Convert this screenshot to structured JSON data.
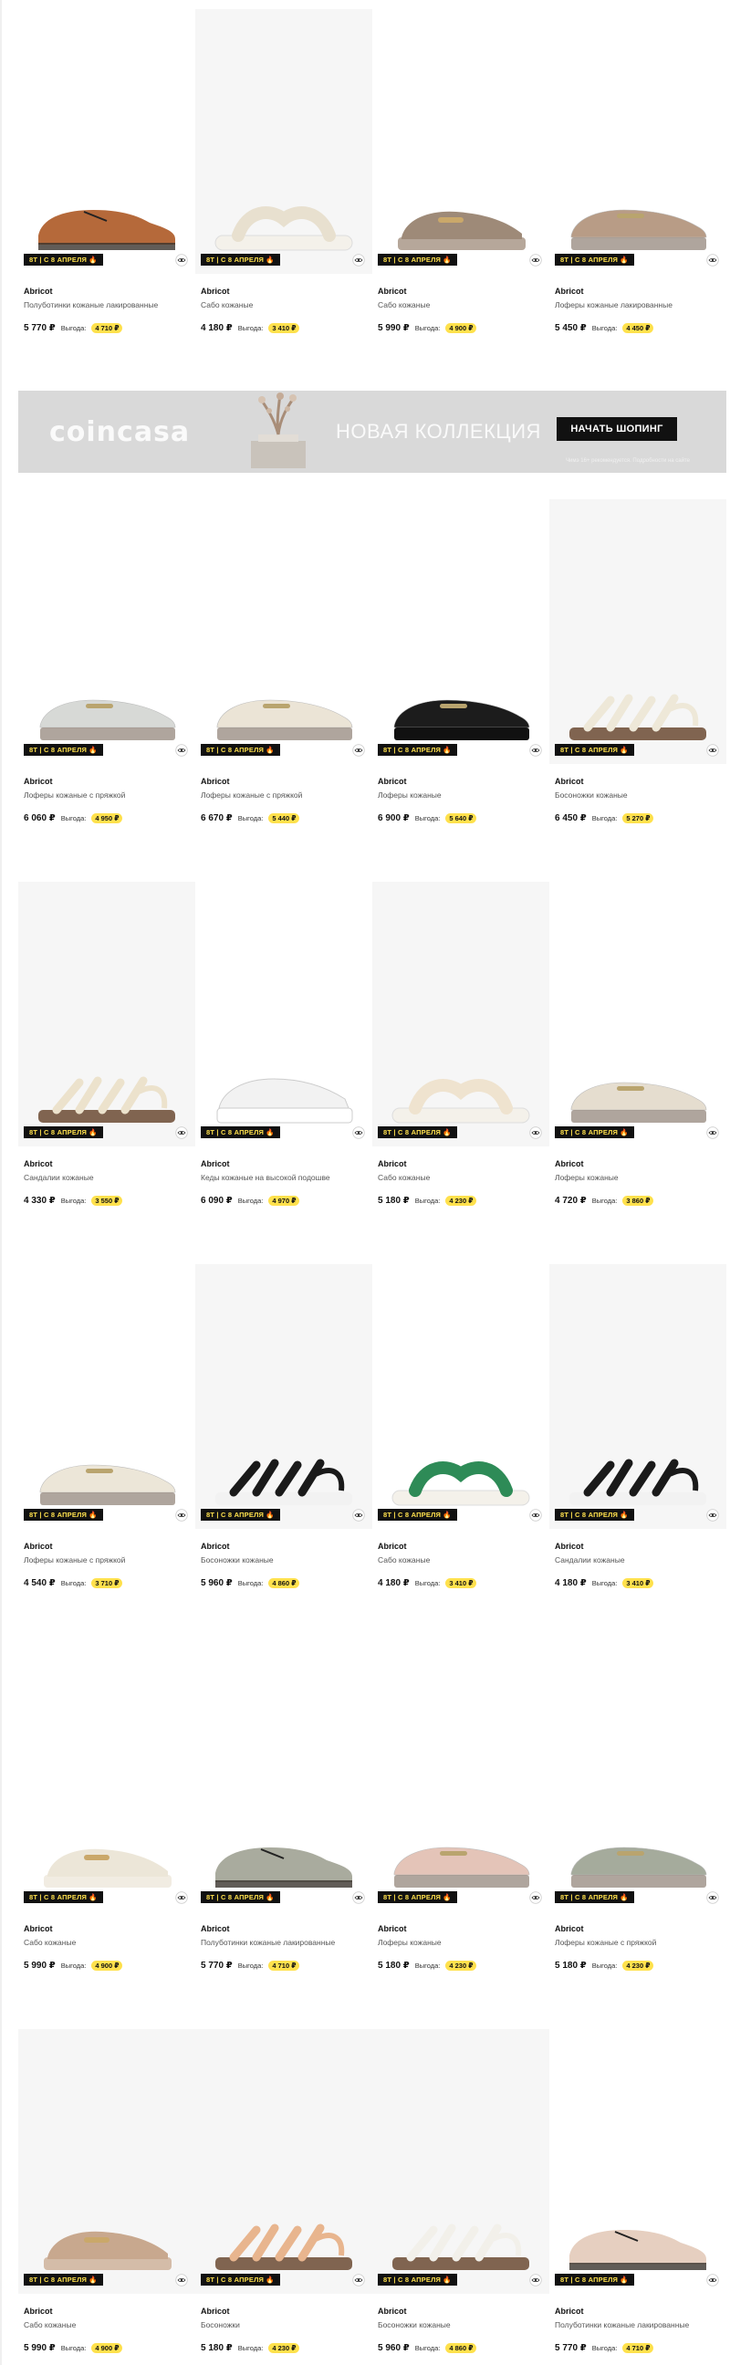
{
  "badge_text": "8Т | С 8 АПРЕЛЯ 🔥",
  "gain_label": "Выгода:",
  "banner": {
    "logo": "coincasa",
    "title": "НОВАЯ КОЛЛЕКЦИЯ",
    "cta": "НАЧАТЬ ШОПИНГ",
    "small_text": "Чимэ 16+ рекомендуется. Подробности на сайте"
  },
  "rows": [
    [
      {
        "brand": "Abricot",
        "desc": "Полуботинки кожаные лакированные",
        "price": "5 770 ₽",
        "gain": "4 710 ₽",
        "bg": false,
        "shoe": "oxford",
        "color": "#b5693a"
      },
      {
        "brand": "Abricot",
        "desc": "Сабо кожаные",
        "price": "4 180 ₽",
        "gain": "3 410 ₽",
        "bg": true,
        "shoe": "slide",
        "color": "#e8e0cf"
      },
      {
        "brand": "Abricot",
        "desc": "Сабо кожаные",
        "price": "5 990 ₽",
        "gain": "4 900 ₽",
        "bg": false,
        "shoe": "mule",
        "color": "#9e8a78"
      },
      {
        "brand": "Abricot",
        "desc": "Лоферы кожаные лакированные",
        "price": "5 450 ₽",
        "gain": "4 450 ₽",
        "bg": false,
        "shoe": "loafer",
        "color": "#b89c86"
      }
    ],
    [
      {
        "brand": "Abricot",
        "desc": "Лоферы кожаные с пряжкой",
        "price": "6 060 ₽",
        "gain": "4 950 ₽",
        "bg": false,
        "shoe": "loafer",
        "color": "#d7d9d6"
      },
      {
        "brand": "Abricot",
        "desc": "Лоферы кожаные с пряжкой",
        "price": "6 670 ₽",
        "gain": "5 440 ₽",
        "bg": false,
        "shoe": "loafer",
        "color": "#ebe4d6"
      },
      {
        "brand": "Abricot",
        "desc": "Лоферы кожаные",
        "price": "6 900 ₽",
        "gain": "5 640 ₽",
        "bg": false,
        "shoe": "loafer",
        "color": "#1c1c1c"
      },
      {
        "brand": "Abricot",
        "desc": "Босоножки кожаные",
        "price": "6 450 ₽",
        "gain": "5 270 ₽",
        "bg": true,
        "shoe": "sandal",
        "color": "#eee8d8"
      }
    ],
    [
      {
        "brand": "Abricot",
        "desc": "Сандалии кожаные",
        "price": "4 330 ₽",
        "gain": "3 550 ₽",
        "bg": true,
        "shoe": "sandal",
        "color": "#ece2cc"
      },
      {
        "brand": "Abricot",
        "desc": "Кеды кожаные на высокой подошве",
        "price": "6 090 ₽",
        "gain": "4 970 ₽",
        "bg": false,
        "shoe": "sneaker",
        "color": "#f2f2f2"
      },
      {
        "brand": "Abricot",
        "desc": "Сабо кожаные",
        "price": "5 180 ₽",
        "gain": "4 230 ₽",
        "bg": true,
        "shoe": "slide",
        "color": "#efe3cf"
      },
      {
        "brand": "Abricot",
        "desc": "Лоферы кожаные",
        "price": "4 720 ₽",
        "gain": "3 860 ₽",
        "bg": false,
        "shoe": "loafer",
        "color": "#e5ddcf"
      }
    ],
    [
      {
        "brand": "Abricot",
        "desc": "Лоферы кожаные с пряжкой",
        "price": "4 540 ₽",
        "gain": "3 710 ₽",
        "bg": false,
        "shoe": "loafer",
        "color": "#ece6d8"
      },
      {
        "brand": "Abricot",
        "desc": "Босоножки кожаные",
        "price": "5 960 ₽",
        "gain": "4 860 ₽",
        "bg": true,
        "shoe": "sandal",
        "color": "#1a1a1a"
      },
      {
        "brand": "Abricot",
        "desc": "Сабо кожаные",
        "price": "4 180 ₽",
        "gain": "3 410 ₽",
        "bg": false,
        "shoe": "slide",
        "color": "#2e8b57"
      },
      {
        "brand": "Abricot",
        "desc": "Сандалии кожаные",
        "price": "4 180 ₽",
        "gain": "3 410 ₽",
        "bg": true,
        "shoe": "sandal",
        "color": "#1a1a1a"
      }
    ],
    [
      {
        "brand": "Abricot",
        "desc": "Сабо кожаные",
        "price": "5 990 ₽",
        "gain": "4 900 ₽",
        "bg": false,
        "shoe": "mule",
        "color": "#ece6d8"
      },
      {
        "brand": "Abricot",
        "desc": "Полуботинки кожаные лакированные",
        "price": "5 770 ₽",
        "gain": "4 710 ₽",
        "bg": false,
        "shoe": "oxford",
        "color": "#a9ab9e"
      },
      {
        "brand": "Abricot",
        "desc": "Лоферы кожаные",
        "price": "5 180 ₽",
        "gain": "4 230 ₽",
        "bg": false,
        "shoe": "loafer",
        "color": "#e4c4b8"
      },
      {
        "brand": "Abricot",
        "desc": "Лоферы кожаные с пряжкой",
        "price": "5 180 ₽",
        "gain": "4 230 ₽",
        "bg": false,
        "shoe": "loafer",
        "color": "#a5ab9c"
      }
    ],
    [
      {
        "brand": "Abricot",
        "desc": "Сабо кожаные",
        "price": "5 990 ₽",
        "gain": "4 900 ₽",
        "bg": true,
        "shoe": "mule",
        "color": "#c8a88e"
      },
      {
        "brand": "Abricot",
        "desc": "Босоножки",
        "price": "5 180 ₽",
        "gain": "4 230 ₽",
        "bg": true,
        "shoe": "sandal",
        "color": "#e8b58e"
      },
      {
        "brand": "Abricot",
        "desc": "Босоножки кожаные",
        "price": "5 960 ₽",
        "gain": "4 860 ₽",
        "bg": true,
        "shoe": "sandal",
        "color": "#f2f0ea"
      },
      {
        "brand": "Abricot",
        "desc": "Полуботинки кожаные лакированные",
        "price": "5 770 ₽",
        "gain": "4 710 ₽",
        "bg": false,
        "shoe": "oxford",
        "color": "#e6cfc0"
      }
    ]
  ]
}
